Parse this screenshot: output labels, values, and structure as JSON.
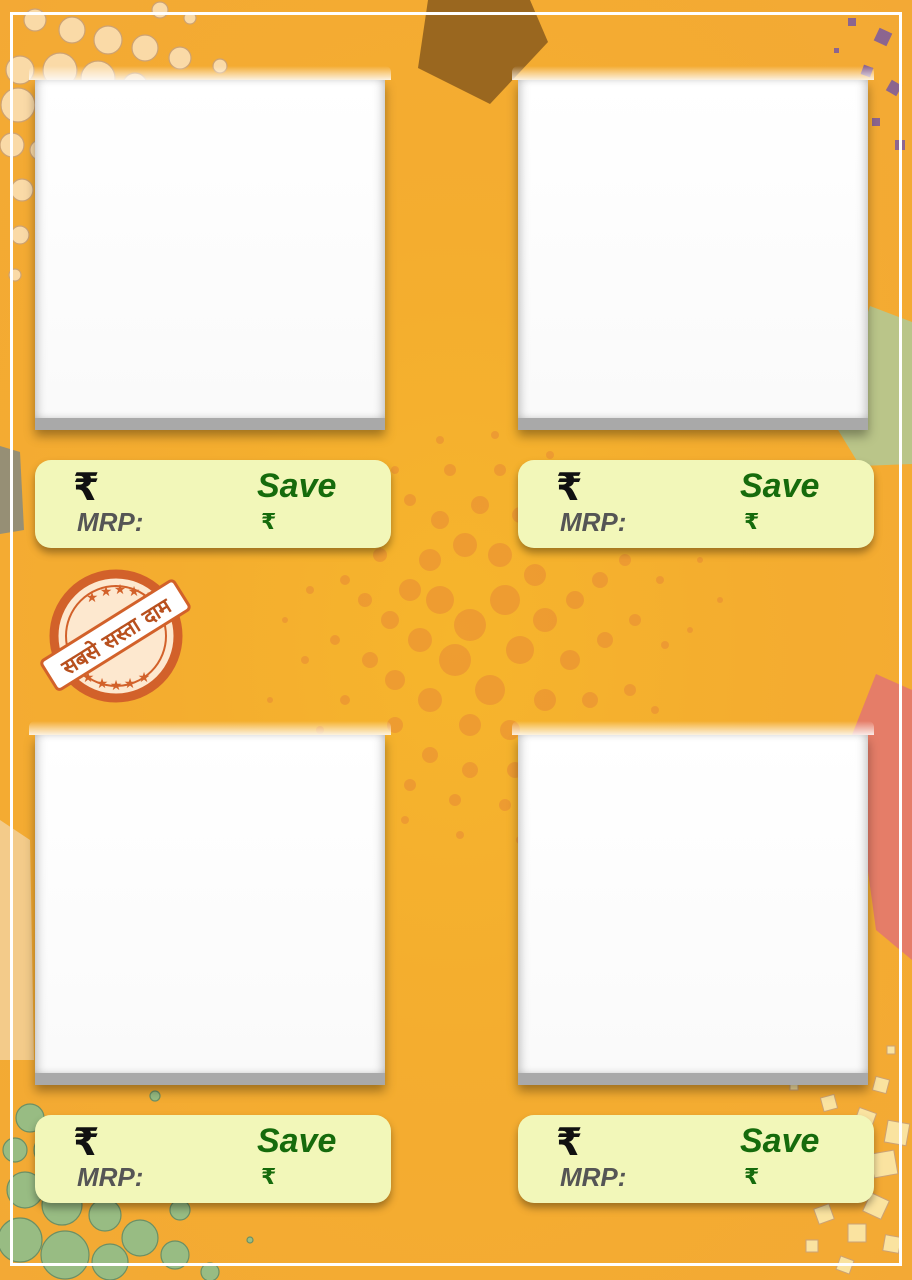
{
  "colors": {
    "background": "#f4ad2f",
    "card_fill": "#f2f7b9",
    "save_green": "#166b0c",
    "mrp_grey": "#555555",
    "stamp_orange": "#d2612a"
  },
  "stamp": {
    "text": "सबसे सस्ता दाम",
    "icon": "star-icon"
  },
  "cards": [
    {
      "currency": "₹",
      "mrp_label": "MRP:",
      "save_label": "Save",
      "save_currency": "₹"
    },
    {
      "currency": "₹",
      "mrp_label": "MRP:",
      "save_label": "Save",
      "save_currency": "₹"
    },
    {
      "currency": "₹",
      "mrp_label": "MRP:",
      "save_label": "Save",
      "save_currency": "₹"
    },
    {
      "currency": "₹",
      "mrp_label": "MRP:",
      "save_label": "Save",
      "save_currency": "₹"
    }
  ]
}
